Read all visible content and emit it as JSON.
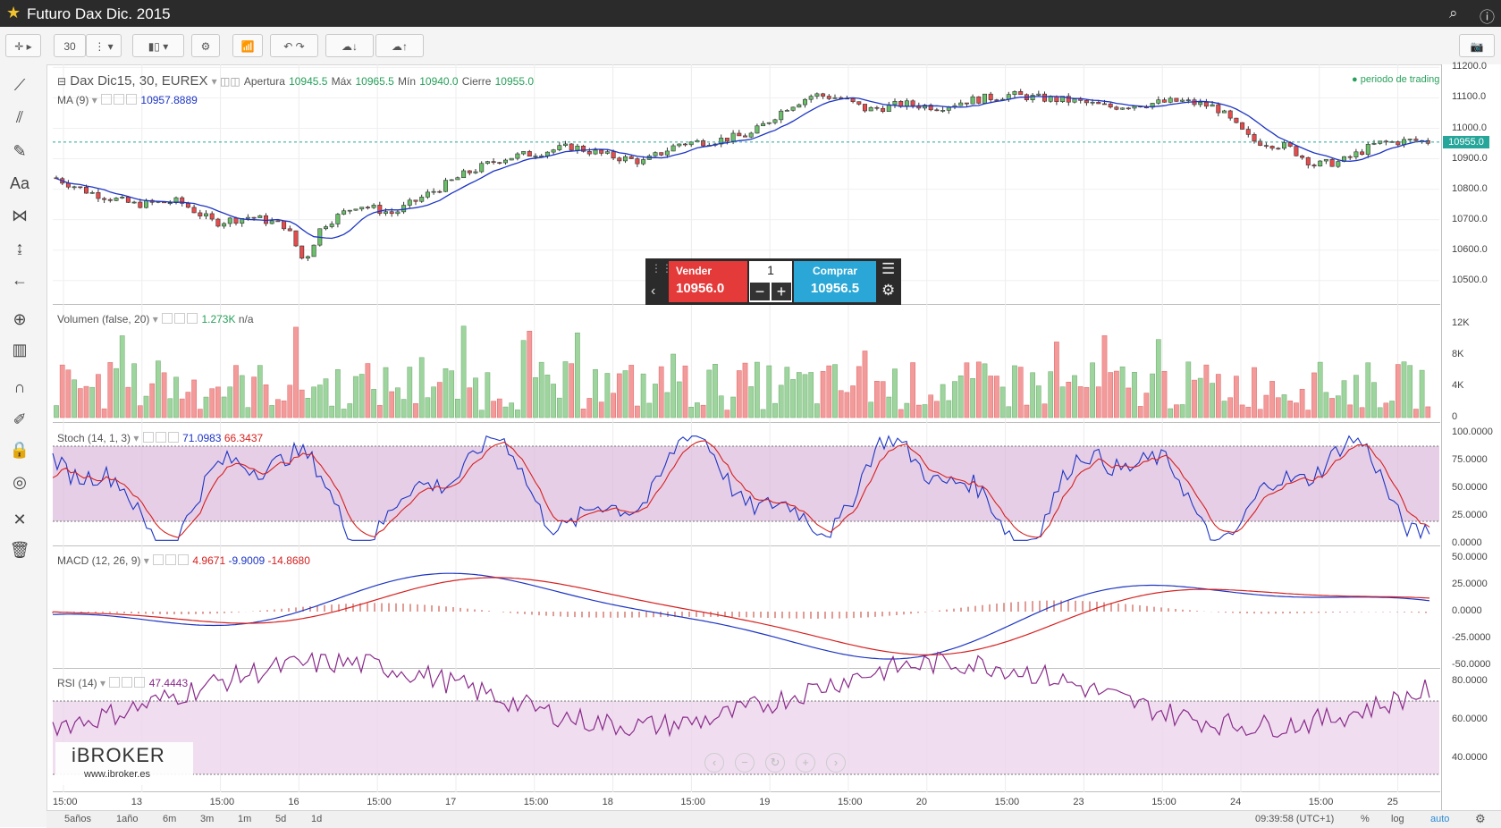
{
  "window": {
    "title": "Futuro Dax Dic. 2015"
  },
  "toolbar": {
    "interval": "30"
  },
  "main_pane": {
    "symbol": "Dax Dic15, 30, EUREX",
    "open_label": "Apertura",
    "open": "10945.5",
    "high_label": "Máx",
    "high": "10965.5",
    "low_label": "Mín",
    "low": "10940.0",
    "close_label": "Cierre",
    "close": "10955.0",
    "ma_label": "MA (9)",
    "ma_value": "10957.8889",
    "session_label": "periodo de trading",
    "last_price": "10955.0",
    "yticks": [
      "11200.0",
      "11100.0",
      "11000.0",
      "10900.0",
      "10800.0",
      "10700.0",
      "10600.0",
      "10500.0"
    ]
  },
  "trade_panel": {
    "sell_label": "Vender",
    "sell_price": "10956.0",
    "quantity": "1",
    "buy_label": "Comprar",
    "buy_price": "10956.5"
  },
  "volume_pane": {
    "label": "Volumen (false, 20)",
    "value": "1.273K",
    "value2": "n/a",
    "yticks": [
      "12K",
      "8K",
      "4K",
      "0"
    ]
  },
  "stoch_pane": {
    "label": "Stoch (14, 1, 3)",
    "k": "71.0983",
    "d": "66.3437",
    "yticks": [
      "100.0000",
      "75.0000",
      "50.0000",
      "25.0000",
      "0.0000"
    ]
  },
  "macd_pane": {
    "label": "MACD (12, 26, 9)",
    "v1": "4.9671",
    "v2": "-9.9009",
    "v3": "-14.8680",
    "yticks": [
      "50.0000",
      "25.0000",
      "0.0000",
      "-25.0000",
      "-50.0000"
    ]
  },
  "rsi_pane": {
    "label": "RSI (14)",
    "value": "47.4443",
    "yticks": [
      "80.0000",
      "60.0000",
      "40.0000"
    ]
  },
  "xaxis": {
    "labels": [
      "15:00",
      "13",
      "15:00",
      "16",
      "15:00",
      "17",
      "15:00",
      "18",
      "15:00",
      "19",
      "15:00",
      "20",
      "15:00",
      "23",
      "15:00",
      "24",
      "15:00",
      "25"
    ]
  },
  "bottom": {
    "ranges": [
      "5años",
      "1año",
      "6m",
      "3m",
      "1m",
      "5d",
      "1d"
    ],
    "time": "09:39:58 (UTC+1)",
    "pct": "%",
    "log": "log",
    "auto": "auto"
  },
  "logo": {
    "brand": "iBROKER",
    "url": "www.ibroker.es"
  },
  "colors": {
    "up": "#6abf69",
    "down": "#e74c4c",
    "ma": "#1d35c4",
    "stoch_fill": "#dcb9dc",
    "rsi": "#8a2a8a"
  }
}
